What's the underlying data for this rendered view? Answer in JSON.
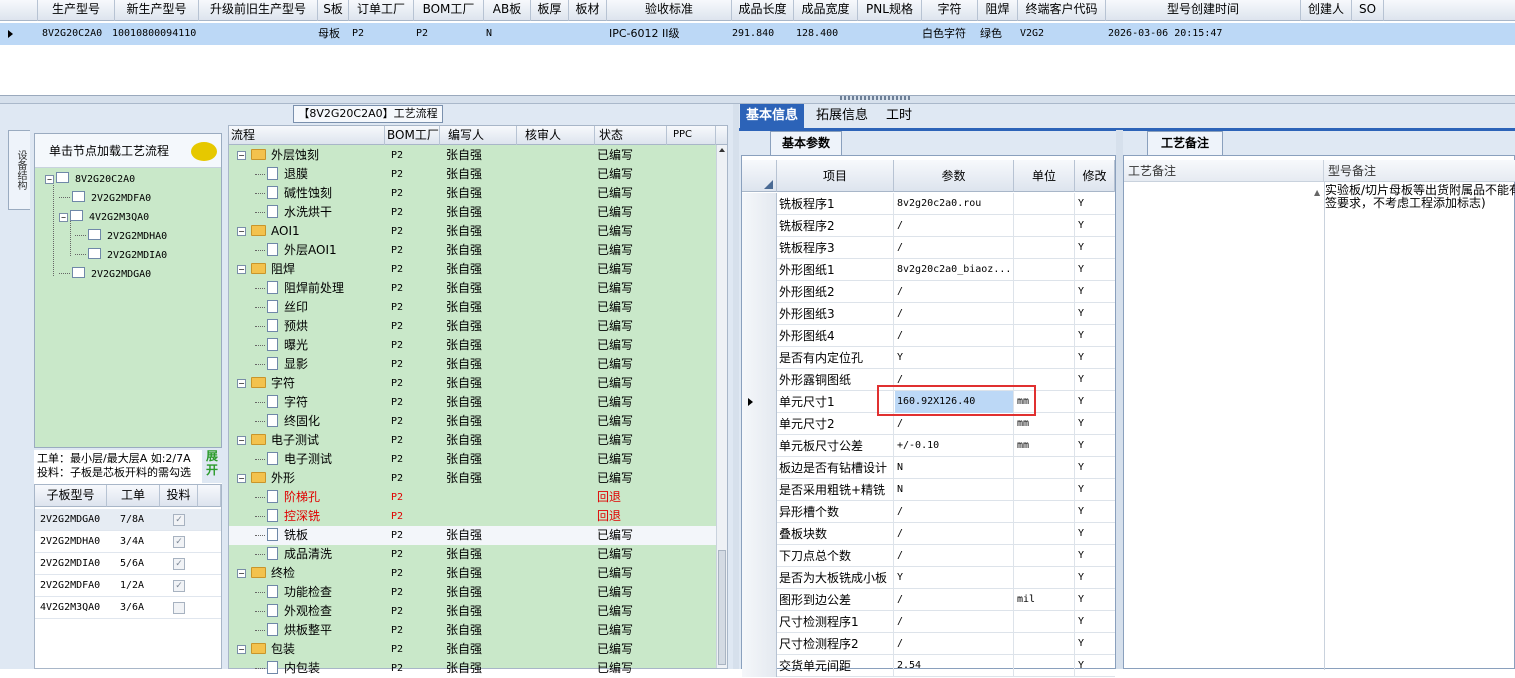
{
  "top_grid": {
    "headers": [
      "生产型号",
      "新生产型号",
      "升级前旧生产型号",
      "S板",
      "订单工厂",
      "BOM工厂",
      "AB板",
      "板厚",
      "板材",
      "验收标准",
      "成品长度",
      "成品宽度",
      "PNL规格",
      "字符",
      "阻焊",
      "终端客户代码",
      "型号创建时间",
      "创建人",
      "SO"
    ],
    "row": {
      "prod_model": "8V2G20C2A0",
      "new_prod_model": "10010800094110",
      "old_prod_model": "",
      "s_board": "母板",
      "order_factory": "P2",
      "bom_factory": "P2",
      "ab_board": "N",
      "thickness": "",
      "material": "",
      "acceptance": "IPC-6012 II级",
      "length": "291.840",
      "width": "128.400",
      "pnl": "",
      "silkscreen": "白色字符",
      "soldermask": "绿色",
      "customer_code": "V2G2",
      "created_time": "2026-03-06 20:15:47",
      "creator": "",
      "so": ""
    }
  },
  "left": {
    "side_tab": "设备结构",
    "flow_title": "【8V2G20C2A0】工艺流程",
    "tree_header": "单击节点加载工艺流程",
    "tree": [
      "8V2G20C2A0",
      "2V2G2MDFA0",
      "4V2G2M3QA0",
      "2V2G2MDHA0",
      "2V2G2MDIA0",
      "2V2G2MDGA0"
    ],
    "work_note_1": "工单：最小层/最大层A 如:2/7A",
    "work_note_2": "投料：子板是芯板开料的需勾选",
    "expand_label": "展开",
    "sub_headers": [
      "子板型号",
      "工单",
      "投料"
    ],
    "sub_rows": [
      {
        "model": "2V2G2MDGA0",
        "order": "7/8A",
        "fed": "✓"
      },
      {
        "model": "2V2G2MDHA0",
        "order": "3/4A",
        "fed": "✓"
      },
      {
        "model": "2V2G2MDIA0",
        "order": "5/6A",
        "fed": "✓"
      },
      {
        "model": "2V2G2MDFA0",
        "order": "1/2A",
        "fed": "✓"
      },
      {
        "model": "4V2G2M3QA0",
        "order": "3/6A",
        "fed": ""
      }
    ]
  },
  "flow": {
    "headers": [
      "流程",
      "BOM工厂",
      "编写人",
      "核审人",
      "状态",
      "PPC"
    ],
    "rows": [
      {
        "name": "外层蚀刻",
        "bom": "P2",
        "writer": "张自强",
        "reviewer": "",
        "status": "已编写",
        "ppc": ""
      },
      {
        "name": "退膜",
        "bom": "P2",
        "writer": "张自强",
        "reviewer": "",
        "status": "已编写",
        "ppc": ""
      },
      {
        "name": "碱性蚀刻",
        "bom": "P2",
        "writer": "张自强",
        "reviewer": "",
        "status": "已编写",
        "ppc": ""
      },
      {
        "name": "水洗烘干",
        "bom": "P2",
        "writer": "张自强",
        "reviewer": "",
        "status": "已编写",
        "ppc": ""
      },
      {
        "name": "AOI1",
        "bom": "P2",
        "writer": "张自强",
        "reviewer": "",
        "status": "已编写",
        "ppc": ""
      },
      {
        "name": "外层AOI1",
        "bom": "P2",
        "writer": "张自强",
        "reviewer": "",
        "status": "已编写",
        "ppc": ""
      },
      {
        "name": "阻焊",
        "bom": "P2",
        "writer": "张自强",
        "reviewer": "",
        "status": "已编写",
        "ppc": ""
      },
      {
        "name": "阻焊前处理",
        "bom": "P2",
        "writer": "张自强",
        "reviewer": "",
        "status": "已编写",
        "ppc": ""
      },
      {
        "name": "丝印",
        "bom": "P2",
        "writer": "张自强",
        "reviewer": "",
        "status": "已编写",
        "ppc": ""
      },
      {
        "name": "预烘",
        "bom": "P2",
        "writer": "张自强",
        "reviewer": "",
        "status": "已编写",
        "ppc": ""
      },
      {
        "name": "曝光",
        "bom": "P2",
        "writer": "张自强",
        "reviewer": "",
        "status": "已编写",
        "ppc": ""
      },
      {
        "name": "显影",
        "bom": "P2",
        "writer": "张自强",
        "reviewer": "",
        "status": "已编写",
        "ppc": ""
      },
      {
        "name": "字符",
        "bom": "P2",
        "writer": "张自强",
        "reviewer": "",
        "status": "已编写",
        "ppc": ""
      },
      {
        "name": "字符",
        "bom": "P2",
        "writer": "张自强",
        "reviewer": "",
        "status": "已编写",
        "ppc": ""
      },
      {
        "name": "终固化",
        "bom": "P2",
        "writer": "张自强",
        "reviewer": "",
        "status": "已编写",
        "ppc": ""
      },
      {
        "name": "电子测试",
        "bom": "P2",
        "writer": "张自强",
        "reviewer": "",
        "status": "已编写",
        "ppc": ""
      },
      {
        "name": "电子测试",
        "bom": "P2",
        "writer": "张自强",
        "reviewer": "",
        "status": "已编写",
        "ppc": ""
      },
      {
        "name": "外形",
        "bom": "P2",
        "writer": "张自强",
        "reviewer": "",
        "status": "已编写",
        "ppc": ""
      },
      {
        "name": "阶梯孔",
        "bom": "P2",
        "writer": "",
        "reviewer": "",
        "status": "回退",
        "ppc": ""
      },
      {
        "name": "控深铣",
        "bom": "P2",
        "writer": "",
        "reviewer": "",
        "status": "回退",
        "ppc": ""
      },
      {
        "name": "铣板",
        "bom": "P2",
        "writer": "张自强",
        "reviewer": "",
        "status": "已编写",
        "ppc": ""
      },
      {
        "name": "成品清洗",
        "bom": "P2",
        "writer": "张自强",
        "reviewer": "",
        "status": "已编写",
        "ppc": ""
      },
      {
        "name": "终检",
        "bom": "P2",
        "writer": "张自强",
        "reviewer": "",
        "status": "已编写",
        "ppc": ""
      },
      {
        "name": "功能检查",
        "bom": "P2",
        "writer": "张自强",
        "reviewer": "",
        "status": "已编写",
        "ppc": ""
      },
      {
        "name": "外观检查",
        "bom": "P2",
        "writer": "张自强",
        "reviewer": "",
        "status": "已编写",
        "ppc": ""
      },
      {
        "name": "烘板整平",
        "bom": "P2",
        "writer": "张自强",
        "reviewer": "",
        "status": "已编写",
        "ppc": ""
      },
      {
        "name": "包装",
        "bom": "P2",
        "writer": "张自强",
        "reviewer": "",
        "status": "已编写",
        "ppc": ""
      },
      {
        "name": "内包装",
        "bom": "P2",
        "writer": "张自强",
        "reviewer": "",
        "status": "已编写",
        "ppc": ""
      }
    ]
  },
  "right": {
    "tabs": [
      "基本信息",
      "拓展信息",
      "工时"
    ],
    "sub_tab": "基本参数",
    "note_tab": "工艺备注",
    "param_headers": [
      "项目",
      "参数",
      "单位",
      "修改"
    ],
    "params": [
      {
        "item": "铣板程序1",
        "value": "8v2g20c2a0.rou",
        "unit": "",
        "mod": "Y"
      },
      {
        "item": "铣板程序2",
        "value": "/",
        "unit": "",
        "mod": "Y"
      },
      {
        "item": "铣板程序3",
        "value": "/",
        "unit": "",
        "mod": "Y"
      },
      {
        "item": "外形图纸1",
        "value": "8v2g20c2a0_biaoz...",
        "unit": "",
        "mod": "Y"
      },
      {
        "item": "外形图纸2",
        "value": "/",
        "unit": "",
        "mod": "Y"
      },
      {
        "item": "外形图纸3",
        "value": "/",
        "unit": "",
        "mod": "Y"
      },
      {
        "item": "外形图纸4",
        "value": "/",
        "unit": "",
        "mod": "Y"
      },
      {
        "item": "是否有内定位孔",
        "value": "Y",
        "unit": "",
        "mod": "Y"
      },
      {
        "item": "外形露铜图纸",
        "value": "/",
        "unit": "",
        "mod": "Y"
      },
      {
        "item": "单元尺寸1",
        "value": "160.92X126.40",
        "unit": "mm",
        "mod": "Y"
      },
      {
        "item": "单元尺寸2",
        "value": "/",
        "unit": "mm",
        "mod": "Y"
      },
      {
        "item": "单元板尺寸公差",
        "value": "+/-0.10",
        "unit": "mm",
        "mod": "Y"
      },
      {
        "item": "板边是否有钻槽设计",
        "value": "N",
        "unit": "",
        "mod": "Y"
      },
      {
        "item": "是否采用粗铣+精铣",
        "value": "N",
        "unit": "",
        "mod": "Y"
      },
      {
        "item": "异形槽个数",
        "value": "/",
        "unit": "",
        "mod": "Y"
      },
      {
        "item": "叠板块数",
        "value": "/",
        "unit": "",
        "mod": "Y"
      },
      {
        "item": "下刀点总个数",
        "value": "/",
        "unit": "",
        "mod": "Y"
      },
      {
        "item": "是否为大板铣成小板",
        "value": "Y",
        "unit": "",
        "mod": "Y"
      },
      {
        "item": "图形到边公差",
        "value": "/",
        "unit": "mil",
        "mod": "Y"
      },
      {
        "item": "尺寸检测程序1",
        "value": "/",
        "unit": "",
        "mod": "Y"
      },
      {
        "item": "尺寸检测程序2",
        "value": "/",
        "unit": "",
        "mod": "Y"
      },
      {
        "item": "交货单元间距",
        "value": "2.54",
        "unit": "",
        "mod": "Y"
      }
    ],
    "notes_headers": [
      "工艺备注",
      "型号备注"
    ],
    "model_note_line1": "实验板/切片母板等出货附属品不能有",
    "model_note_line2": "签要求，不考虑工程添加标志)"
  }
}
